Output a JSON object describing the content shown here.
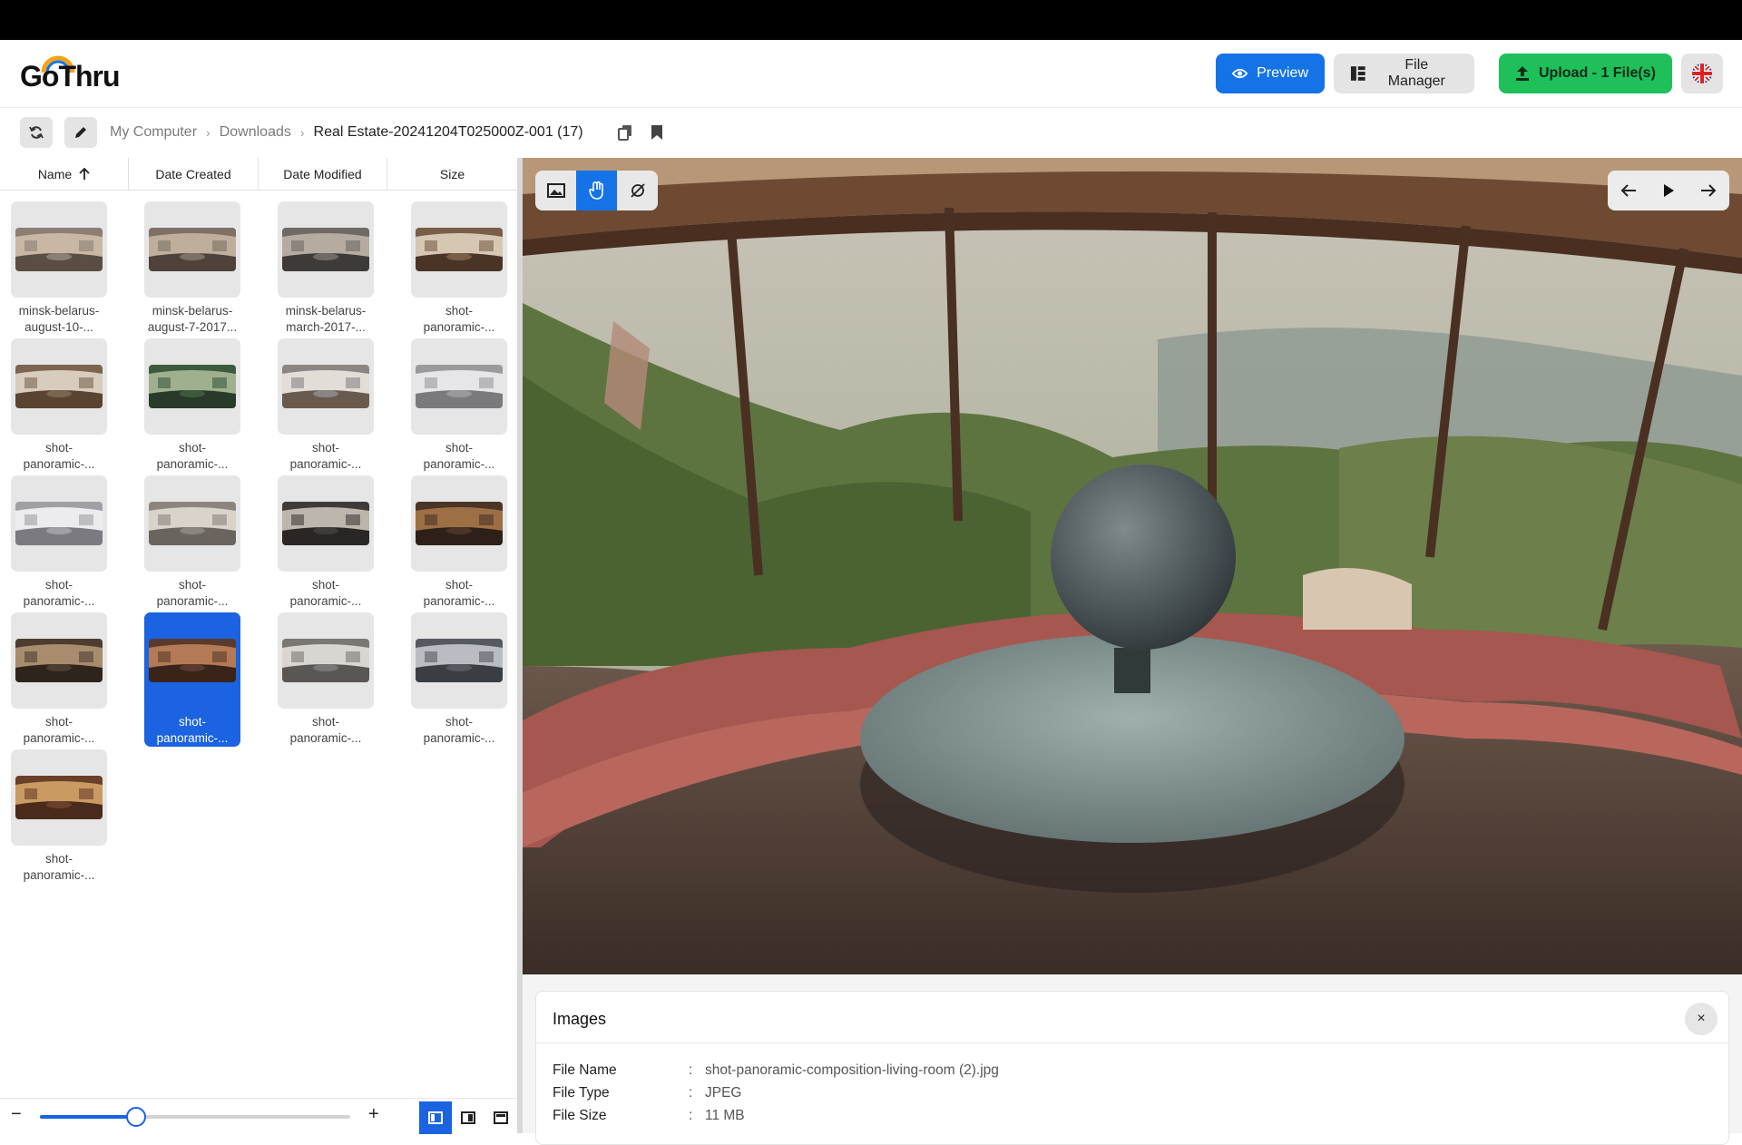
{
  "app": {
    "logo_text": "GoThru"
  },
  "header": {
    "preview_label": "Preview",
    "file_manager_label": "File Manager",
    "upload_label": "Upload - 1 File(s)",
    "language": "uk-flag-icon"
  },
  "breadcrumb": {
    "items": [
      "My Computer",
      "Downloads",
      "Real Estate-20241204T025000Z-001 (17)"
    ]
  },
  "columns": [
    "Name",
    "Date Created",
    "Date Modified",
    "Size"
  ],
  "files": [
    {
      "line1": "minsk-belarus-",
      "line2": "august-10-..."
    },
    {
      "line1": "minsk-belarus-",
      "line2": "august-7-2017..."
    },
    {
      "line1": "minsk-belarus-",
      "line2": "march-2017-..."
    },
    {
      "line1": "shot-",
      "line2": "panoramic-..."
    },
    {
      "line1": "shot-",
      "line2": "panoramic-..."
    },
    {
      "line1": "shot-",
      "line2": "panoramic-..."
    },
    {
      "line1": "shot-",
      "line2": "panoramic-..."
    },
    {
      "line1": "shot-",
      "line2": "panoramic-..."
    },
    {
      "line1": "shot-",
      "line2": "panoramic-..."
    },
    {
      "line1": "shot-",
      "line2": "panoramic-..."
    },
    {
      "line1": "shot-",
      "line2": "panoramic-..."
    },
    {
      "line1": "shot-",
      "line2": "panoramic-..."
    },
    {
      "line1": "shot-",
      "line2": "panoramic-..."
    },
    {
      "line1": "shot-",
      "line2": "panoramic-..."
    },
    {
      "line1": "shot-",
      "line2": "panoramic-..."
    },
    {
      "line1": "shot-",
      "line2": "panoramic-..."
    },
    {
      "line1": "shot-",
      "line2": "panoramic-..."
    }
  ],
  "selected_index": 13,
  "zoom": {
    "minus": "−",
    "plus": "+",
    "level": 0.31
  },
  "info_panel": {
    "title": "Images",
    "close": "×",
    "rows": [
      {
        "key": "File Name",
        "sep": ":",
        "value": "shot-panoramic-composition-living-room (2).jpg"
      },
      {
        "key": "File Type",
        "sep": ":",
        "value": "JPEG"
      },
      {
        "key": "File Size",
        "sep": ":",
        "value": "11 MB"
      }
    ]
  },
  "colors": {
    "accent": "#1473e6",
    "upload": "#1fbf5a",
    "selected": "#1b63e0"
  }
}
